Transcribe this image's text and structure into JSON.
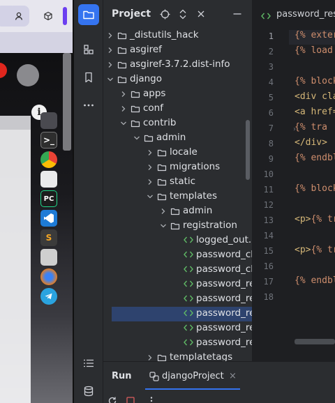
{
  "colors": {
    "accent": "#3574f0",
    "selection": "#2e436e",
    "folder_icon": "#ced0d6",
    "html_icon": "#5fb865",
    "template_keyword": "#cf8e6d",
    "html_tag": "#d5b778"
  },
  "toolstrip": {
    "icons": [
      "project-folder-icon",
      "structure-icon",
      "bookmarks-icon",
      "more-icon",
      "todo-list-icon",
      "database-icon"
    ]
  },
  "project": {
    "title": "Project",
    "header_icons": [
      "locate-icon",
      "expand-collapse-icon",
      "close-icon",
      "minimize-icon"
    ],
    "tree": [
      {
        "label": "_distutils_hack",
        "type": "folder",
        "indent": 0,
        "expanded": false
      },
      {
        "label": "asgiref",
        "type": "folder",
        "indent": 0,
        "expanded": false
      },
      {
        "label": "asgiref-3.7.2.dist-info",
        "type": "folder",
        "indent": 0,
        "expanded": false
      },
      {
        "label": "django",
        "type": "folder",
        "indent": 0,
        "expanded": true
      },
      {
        "label": "apps",
        "type": "folder",
        "indent": 1,
        "expanded": false
      },
      {
        "label": "conf",
        "type": "folder",
        "indent": 1,
        "expanded": false
      },
      {
        "label": "contrib",
        "type": "folder",
        "indent": 1,
        "expanded": true
      },
      {
        "label": "admin",
        "type": "folder",
        "indent": 2,
        "expanded": true
      },
      {
        "label": "locale",
        "type": "folder",
        "indent": 3,
        "expanded": false
      },
      {
        "label": "migrations",
        "type": "folder",
        "indent": 3,
        "expanded": false
      },
      {
        "label": "static",
        "type": "folder",
        "indent": 3,
        "expanded": false
      },
      {
        "label": "templates",
        "type": "folder",
        "indent": 3,
        "expanded": true
      },
      {
        "label": "admin",
        "type": "folder",
        "indent": 4,
        "expanded": false
      },
      {
        "label": "registration",
        "type": "folder",
        "indent": 4,
        "expanded": true
      },
      {
        "label": "logged_out.h",
        "type": "html",
        "indent": 5
      },
      {
        "label": "password_ch",
        "type": "html",
        "indent": 5
      },
      {
        "label": "password_ch",
        "type": "html",
        "indent": 5
      },
      {
        "label": "password_re",
        "type": "html",
        "indent": 5
      },
      {
        "label": "password_re",
        "type": "html",
        "indent": 5
      },
      {
        "label": "password_re",
        "type": "html",
        "indent": 5,
        "selected": true
      },
      {
        "label": "password_re",
        "type": "html",
        "indent": 5
      },
      {
        "label": "password_re",
        "type": "html",
        "indent": 5
      },
      {
        "label": "templatetags",
        "type": "folder",
        "indent": 3,
        "expanded": false
      }
    ]
  },
  "editor": {
    "tab_label": "password_res",
    "current_line": 1,
    "lines": [
      {
        "n": "1",
        "parts": [
          {
            "t": "{% exter",
            "c": "tpl"
          }
        ]
      },
      {
        "n": "2",
        "parts": [
          {
            "t": "{% load ",
            "c": "tpl"
          }
        ]
      },
      {
        "n": "3",
        "parts": []
      },
      {
        "n": "4",
        "parts": [
          {
            "t": "{% block",
            "c": "tpl"
          }
        ]
      },
      {
        "n": "5",
        "parts": [
          {
            "t": "<div cla",
            "c": "tag"
          }
        ]
      },
      {
        "n": "6",
        "parts": [
          {
            "t": "<a href=",
            "c": "tag"
          }
        ]
      },
      {
        "n": "7",
        "parts": [
          {
            "t": "  {% tra",
            "c": "tpl"
          }
        ]
      },
      {
        "n": "8",
        "parts": [
          {
            "t": "</div>",
            "c": "tag"
          }
        ]
      },
      {
        "n": "9",
        "parts": [
          {
            "t": "{% endbl",
            "c": "tpl"
          }
        ]
      },
      {
        "n": "10",
        "parts": []
      },
      {
        "n": "11",
        "parts": [
          {
            "t": "{% block",
            "c": "tpl"
          }
        ]
      },
      {
        "n": "12",
        "parts": []
      },
      {
        "n": "13",
        "parts": [
          {
            "t": "<p>",
            "c": "tag"
          },
          {
            "t": "{% tr",
            "c": "tpl"
          }
        ]
      },
      {
        "n": "14",
        "parts": []
      },
      {
        "n": "15",
        "parts": [
          {
            "t": "<p>",
            "c": "tag"
          },
          {
            "t": "{% tr",
            "c": "tpl"
          }
        ]
      },
      {
        "n": "16",
        "parts": []
      },
      {
        "n": "17",
        "parts": [
          {
            "t": "{% endbl",
            "c": "tpl"
          }
        ]
      },
      {
        "n": "18",
        "parts": []
      }
    ]
  },
  "run": {
    "title": "Run",
    "tab_label": "djangoProject",
    "close_glyph": "×"
  }
}
